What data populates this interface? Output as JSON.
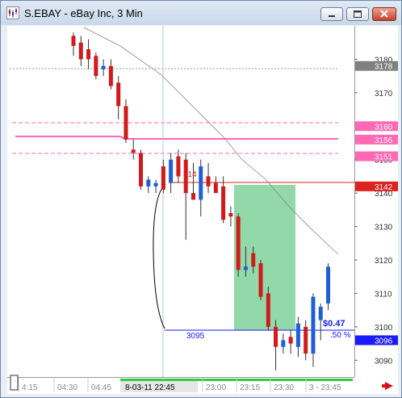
{
  "window": {
    "title": "S.EBAY - eBay Inc, 3 Min",
    "controls": [
      "minimize",
      "maximize",
      "close"
    ]
  },
  "chart_data": {
    "type": "candlestick",
    "instrument": "S.EBAY",
    "price_axis": {
      "ticks": [
        "3180",
        "3170",
        "3160",
        "3150",
        "3140",
        "3130",
        "3120",
        "3110",
        "3100",
        "3090"
      ],
      "ylim": [
        3085,
        3190
      ]
    },
    "time_axis": {
      "labels": [
        "4:15",
        "04:30",
        "04:45",
        "23:00",
        "23:15",
        "23:30",
        "3 - 23:45"
      ],
      "cursor_label": "8-03-11  22:45"
    },
    "price_tags": [
      {
        "value": "3178",
        "color": "#808080"
      },
      {
        "value": "3160",
        "color": "#ff69b4"
      },
      {
        "value": "3156",
        "color": "#ff69b4"
      },
      {
        "value": "3151",
        "color": "#ff69b4"
      },
      {
        "value": "3142",
        "color": "#dd2222"
      },
      {
        "value": "3096",
        "color": "#1a1aff"
      }
    ],
    "annotations": {
      "high_label": "314",
      "low_label": "3095",
      "projection": "$0.47",
      "projection_pct": ".50 %"
    },
    "candles": [
      {
        "o": 3187,
        "h": 3188,
        "l": 3181,
        "c": 3184
      },
      {
        "o": 3185,
        "h": 3187,
        "l": 3178,
        "c": 3180
      },
      {
        "o": 3183,
        "h": 3186,
        "l": 3177,
        "c": 3180
      },
      {
        "o": 3181,
        "h": 3182,
        "l": 3174,
        "c": 3175
      },
      {
        "o": 3177,
        "h": 3180,
        "l": 3175,
        "c": 3178
      },
      {
        "o": 3178,
        "h": 3180,
        "l": 3171,
        "c": 3172
      },
      {
        "o": 3173,
        "h": 3175,
        "l": 3162,
        "c": 3166
      },
      {
        "o": 3166,
        "h": 3168,
        "l": 3155,
        "c": 3156
      },
      {
        "o": 3153,
        "h": 3156,
        "l": 3150,
        "c": 3152
      },
      {
        "o": 3152,
        "h": 3153,
        "l": 3141,
        "c": 3142
      },
      {
        "o": 3142,
        "h": 3145,
        "l": 3140,
        "c": 3144
      },
      {
        "o": 3142,
        "h": 3144,
        "l": 3140,
        "c": 3143
      },
      {
        "o": 3148,
        "h": 3150,
        "l": 3140,
        "c": 3141
      },
      {
        "o": 3143,
        "h": 3152,
        "l": 3140,
        "c": 3150
      },
      {
        "o": 3151,
        "h": 3153,
        "l": 3143,
        "c": 3145
      },
      {
        "o": 3150,
        "h": 3152,
        "l": 3126,
        "c": 3140
      },
      {
        "o": 3140,
        "h": 3149,
        "l": 3138,
        "c": 3138
      },
      {
        "o": 3138,
        "h": 3150,
        "l": 3133,
        "c": 3148
      },
      {
        "o": 3145,
        "h": 3149,
        "l": 3140,
        "c": 3142
      },
      {
        "o": 3143,
        "h": 3145,
        "l": 3140,
        "c": 3140
      },
      {
        "o": 3142,
        "h": 3145,
        "l": 3131,
        "c": 3132
      },
      {
        "o": 3134,
        "h": 3136,
        "l": 3130,
        "c": 3133
      },
      {
        "o": 3133,
        "h": 3134,
        "l": 3115,
        "c": 3117
      },
      {
        "o": 3117,
        "h": 3124,
        "l": 3115,
        "c": 3118
      },
      {
        "o": 3122,
        "h": 3124,
        "l": 3116,
        "c": 3118
      },
      {
        "o": 3119,
        "h": 3120,
        "l": 3108,
        "c": 3109
      },
      {
        "o": 3110,
        "h": 3112,
        "l": 3099,
        "c": 3100
      },
      {
        "o": 3100,
        "h": 3102,
        "l": 3087,
        "c": 3094
      },
      {
        "o": 3094,
        "h": 3098,
        "l": 3092,
        "c": 3096
      },
      {
        "o": 3097,
        "h": 3099,
        "l": 3092,
        "c": 3095
      },
      {
        "o": 3094,
        "h": 3103,
        "l": 3091,
        "c": 3101
      },
      {
        "o": 3100,
        "h": 3102,
        "l": 3090,
        "c": 3092
      },
      {
        "o": 3092,
        "h": 3110,
        "l": 3088,
        "c": 3109
      },
      {
        "o": 3102,
        "h": 3107,
        "l": 3096,
        "c": 3106
      },
      {
        "o": 3107,
        "h": 3119,
        "l": 3105,
        "c": 3118
      }
    ]
  }
}
